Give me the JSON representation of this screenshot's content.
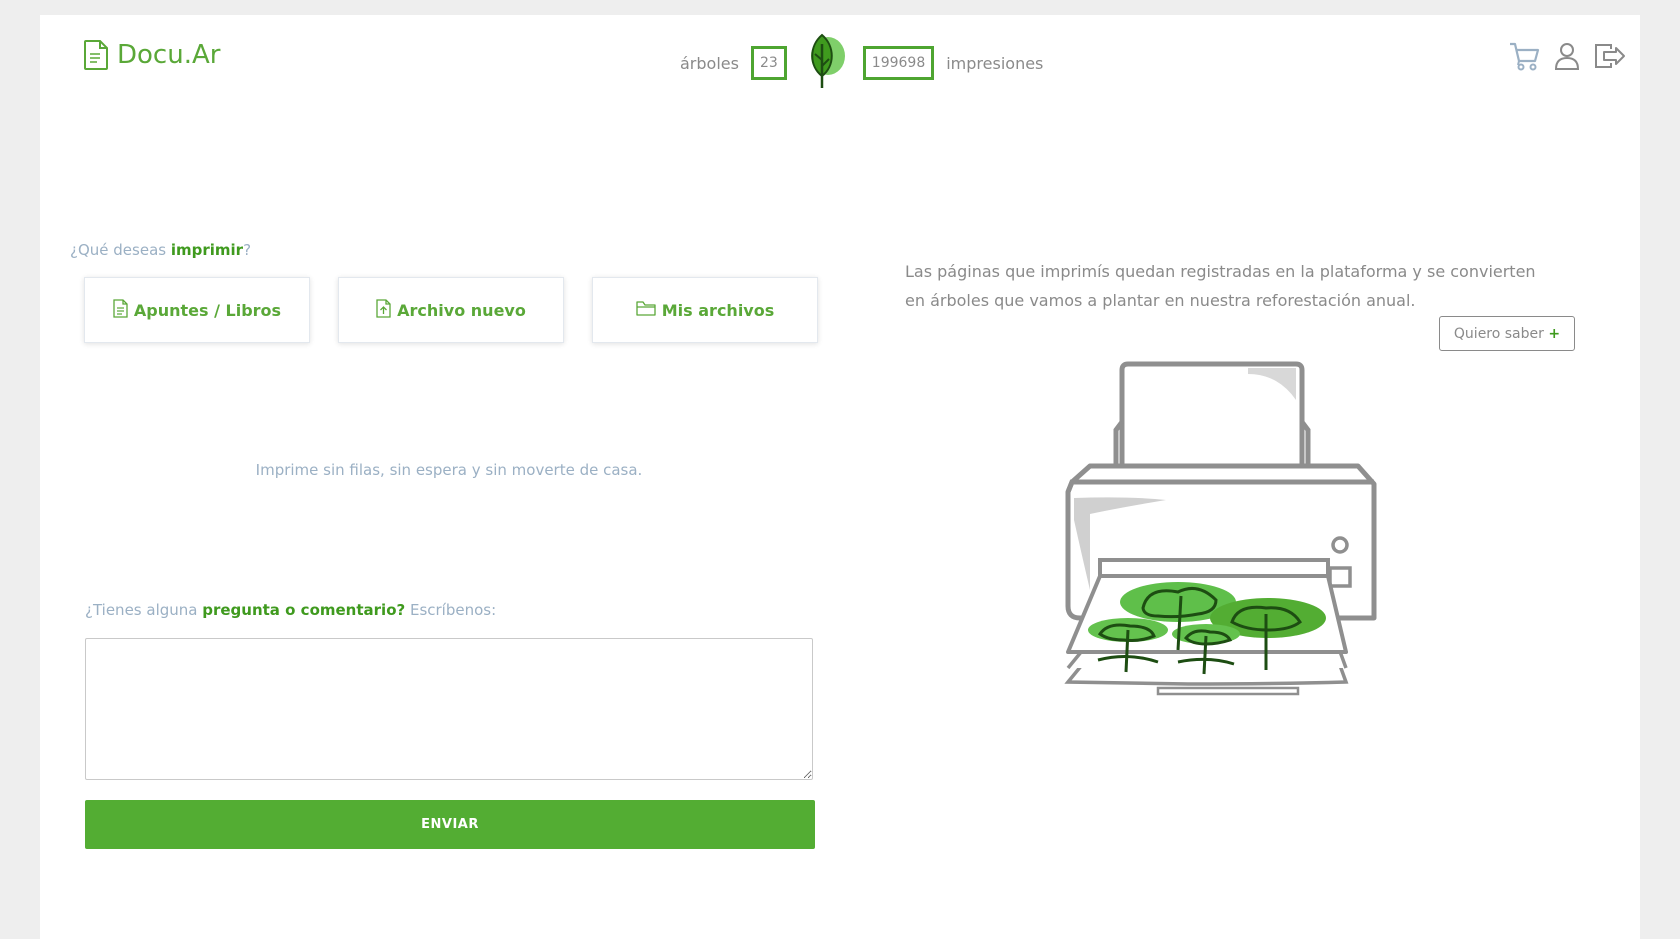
{
  "header": {
    "logo_text": "Docu.Ar",
    "trees_label": "árboles",
    "trees_count": "23",
    "prints_count": "199698",
    "prints_label": "impresiones",
    "icons": [
      "cart-icon",
      "user-icon",
      "logout-icon"
    ]
  },
  "left": {
    "question_prefix": "¿Qué deseas ",
    "question_emphasis": "imprimir",
    "question_suffix": "?",
    "options": [
      {
        "label": "Apuntes / Libros",
        "icon": "document-icon"
      },
      {
        "label": "Archivo nuevo",
        "icon": "upload-file-icon"
      },
      {
        "label": "Mis archivos",
        "icon": "folder-icon"
      }
    ],
    "tagline": "Imprime sin filas, sin espera y sin moverte de casa.",
    "comment_prefix": "¿Tienes alguna ",
    "comment_emphasis": "pregunta o comentario?",
    "comment_suffix": " Escríbenos:",
    "comment_value": "",
    "send_label": "ENVIAR"
  },
  "right": {
    "info_text": "Las páginas que imprimís quedan registradas en la plataforma y se convierten en árboles que vamos a plantar en nuestra reforestación anual.",
    "learn_more_label": "Quiero saber ",
    "learn_more_plus": "+"
  },
  "colors": {
    "brand_green": "#53ad33",
    "muted_text": "#9bb0c4",
    "body_text": "#8a8a8a"
  }
}
